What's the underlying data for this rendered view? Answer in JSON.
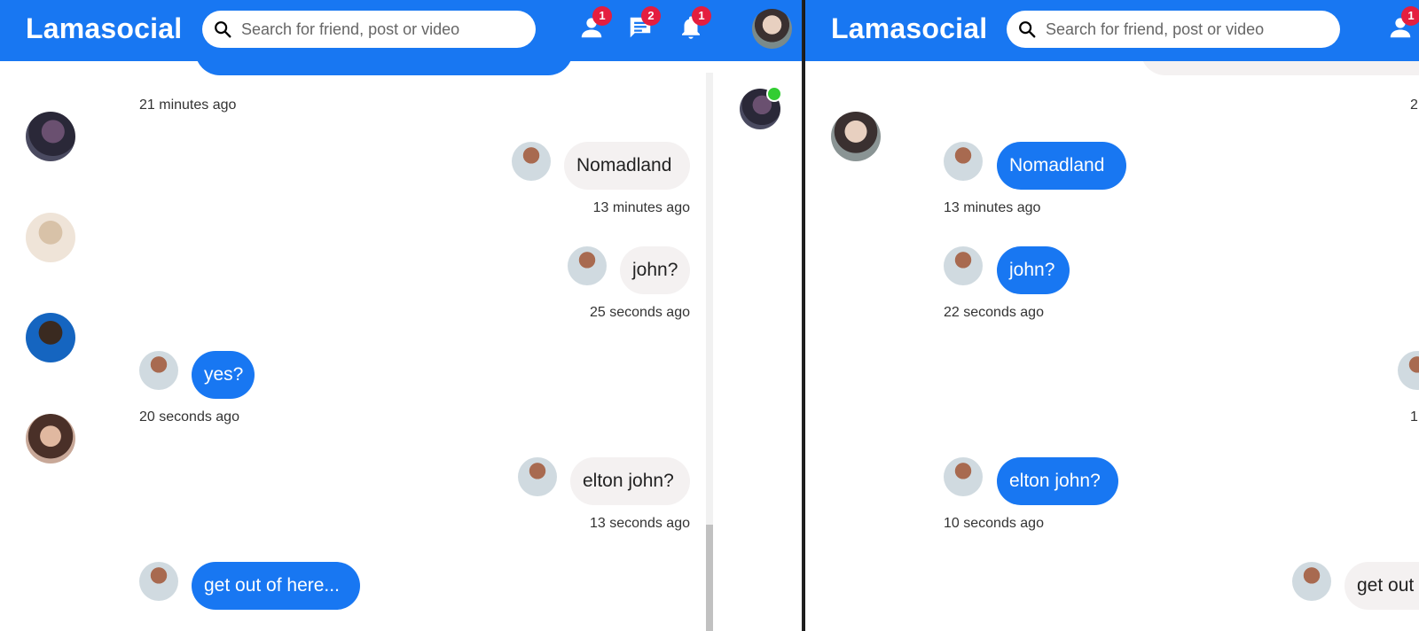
{
  "app": {
    "brand": "Lamasocial",
    "search_placeholder": "Search for friend, post or video",
    "colors": {
      "brand": "#1877f2",
      "badge": "#e41e3f",
      "online": "#32cd32",
      "bubble_own": "#f4f1f1"
    }
  },
  "left": {
    "badges": {
      "friends": "1",
      "messages": "2",
      "notifications": "1"
    },
    "top_timestamp": "21 minutes ago",
    "messages": [
      {
        "text": "Nomadland",
        "time": "13 minutes ago",
        "side": "right"
      },
      {
        "text": "john?",
        "time": "25 seconds ago",
        "side": "right"
      },
      {
        "text": "yes?",
        "time": "20 seconds ago",
        "side": "left"
      },
      {
        "text": "elton john?",
        "time": "13 seconds ago",
        "side": "right"
      },
      {
        "text": "get out of here...",
        "time": "",
        "side": "left"
      }
    ]
  },
  "right": {
    "badges": {
      "friends": "1"
    },
    "top_timestamp_partial": "2",
    "messages": [
      {
        "text": "Nomadland",
        "time": "13 minutes ago",
        "side": "left"
      },
      {
        "text": "john?",
        "time": "22 seconds ago",
        "side": "left"
      },
      {
        "text": "",
        "time": "1",
        "side": "right"
      },
      {
        "text": "elton john?",
        "time": "10 seconds ago",
        "side": "left"
      },
      {
        "text": "get out",
        "time": "",
        "side": "right"
      }
    ]
  },
  "icons": [
    "search-icon",
    "person-icon",
    "chat-icon",
    "bell-icon"
  ]
}
